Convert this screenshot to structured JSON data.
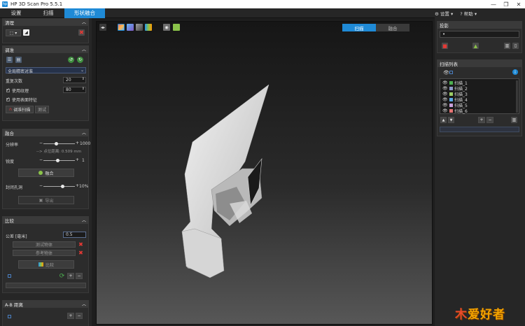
{
  "window": {
    "title": "HP 3D Scan Pro 5.5.1"
  },
  "tabs": [
    {
      "label": "设置"
    },
    {
      "label": "扫描"
    },
    {
      "label": "形状融合"
    }
  ],
  "header_right": {
    "settings": "⚙ 设置 ▾",
    "help": "? 帮助 ▾"
  },
  "left": {
    "trim": {
      "title": "清理"
    },
    "align": {
      "title": "调准",
      "mode": "全局精密对准",
      "iterations_label": "重复次数",
      "iterations": "20",
      "use_texture_label": "使用纹理",
      "use_texture": "80",
      "use_surface_label": "使用表面特征",
      "align_btn": "调准扫描",
      "test_btn": "测试"
    },
    "fusion": {
      "title": "融合",
      "resolution_label": "分辨率",
      "resolution": "1000",
      "resolution_hint": "--> 点位距离: 0.509 mm",
      "sharpness_label": "锐度",
      "sharpness": "1",
      "fuse_btn": "融合",
      "fill_holes_label": "封闭孔洞",
      "fill_holes": "10%",
      "export_btn": "导出"
    },
    "compare": {
      "title": "比较",
      "tolerance_label": "公差 [毫米]",
      "tolerance": "0.5",
      "test_obj": "测试物体",
      "ref_obj": "参考物体",
      "compare_btn": "比较"
    },
    "ab": {
      "title": "A-B 距离"
    }
  },
  "viewport": {
    "seg_scan": "扫描",
    "seg_fusion": "融合"
  },
  "right": {
    "projection": {
      "title": "投影",
      "value": "•"
    },
    "scanlist": {
      "title": "扫描列表",
      "items": [
        {
          "label": "扫描_1",
          "color": "#4caf50"
        },
        {
          "label": "扫描_2",
          "color": "#8e99c9"
        },
        {
          "label": "扫描_3",
          "color": "#9ccc65"
        },
        {
          "label": "扫描_4",
          "color": "#5aa9e6"
        },
        {
          "label": "扫描_5",
          "color": "#c9a0dc"
        },
        {
          "label": "扫描_6",
          "color": "#e57373"
        }
      ]
    }
  },
  "watermark": {
    "text": "爱好者"
  }
}
